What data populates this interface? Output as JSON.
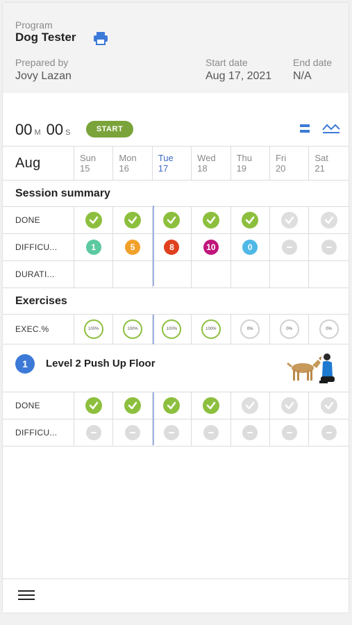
{
  "header": {
    "program_label": "Program",
    "program_name": "Dog Tester",
    "prepared_by_label": "Prepared by",
    "prepared_by": "Jovy Lazan",
    "start_date_label": "Start date",
    "start_date": "Aug 17, 2021",
    "end_date_label": "End date",
    "end_date": "N/A"
  },
  "timer": {
    "minutes": "00",
    "minutes_unit": "M",
    "seconds": "00",
    "seconds_unit": "S",
    "start_label": "START"
  },
  "calendar": {
    "month": "Aug",
    "days": [
      {
        "name": "Sun",
        "num": "15"
      },
      {
        "name": "Mon",
        "num": "16"
      },
      {
        "name": "Tue",
        "num": "17"
      },
      {
        "name": "Wed",
        "num": "18"
      },
      {
        "name": "Thu",
        "num": "19"
      },
      {
        "name": "Fri",
        "num": "20"
      },
      {
        "name": "Sat",
        "num": "21"
      }
    ]
  },
  "session_summary": {
    "title": "Session summary",
    "done_label": "DONE",
    "done": [
      true,
      true,
      true,
      true,
      true,
      false,
      false
    ],
    "difficulty_label": "DIFFICU...",
    "difficulty": [
      {
        "v": "1",
        "color": "#5cc9a0"
      },
      {
        "v": "5",
        "color": "#f1a12a"
      },
      {
        "v": "8",
        "color": "#e0401f"
      },
      {
        "v": "10",
        "color": "#c0157a"
      },
      {
        "v": "0",
        "color": "#4fb8e6"
      },
      {
        "v": null
      },
      {
        "v": null
      }
    ],
    "duration_label": "DURATI..."
  },
  "exercises": {
    "title": "Exercises",
    "exec_label": "EXEC.%",
    "exec": [
      "100%",
      "100%",
      "100%",
      "100%",
      "0%",
      "0%",
      "0%"
    ],
    "items": [
      {
        "number": "1",
        "name": "Level 2 Push Up Floor",
        "done_label": "DONE",
        "done": [
          true,
          true,
          true,
          true,
          false,
          false,
          false
        ],
        "difficulty_label": "DIFFICU..."
      }
    ]
  },
  "colors": {
    "accent_green": "#8dbf3e",
    "start_button": "#7aa33a",
    "today_blue": "#3d6bc4",
    "exercise_badge": "#3d7ad8"
  }
}
